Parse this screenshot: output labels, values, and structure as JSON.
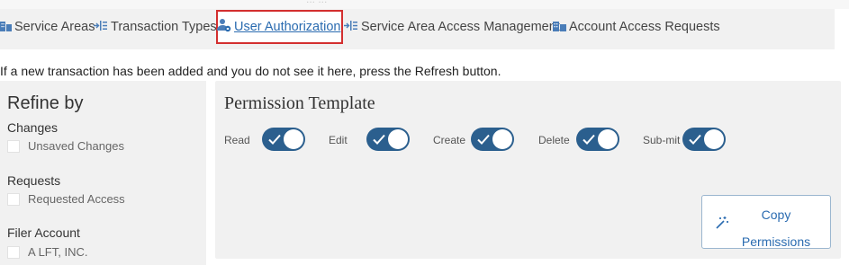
{
  "top_strip_text": "... ...",
  "tabs": [
    {
      "label": "Service Areas",
      "icon": "building-icon"
    },
    {
      "label": "Transaction Types",
      "icon": "list-arrow-icon"
    },
    {
      "label": "User Authorization",
      "icon": "user-lock-icon",
      "active": true
    },
    {
      "label": "Service Area Access Management",
      "icon": "list-arrow-icon"
    },
    {
      "label": "Account Access Requests",
      "icon": "building-icon"
    }
  ],
  "notice": "If a new transaction has been added and you do not see it here, press the Refresh button.",
  "refine": {
    "title": "Refine by",
    "groups": [
      {
        "label": "Changes",
        "option": "Unsaved Changes"
      },
      {
        "label": "Requests",
        "option": "Requested Access"
      },
      {
        "label": "Filer Account",
        "option": "A LFT, INC."
      }
    ]
  },
  "permission_template": {
    "title": "Permission Template",
    "permissions": [
      {
        "label": "Read",
        "enabled": true
      },
      {
        "label": "Edit",
        "enabled": true
      },
      {
        "label": "Create",
        "enabled": true
      },
      {
        "label": "Delete",
        "enabled": true
      },
      {
        "label": "Sub-mit",
        "enabled": true
      }
    ],
    "copy_button": {
      "line1": "Copy",
      "line2": "Permissions",
      "icon": "magic-wand-icon"
    }
  },
  "colors": {
    "accent": "#2a6bb0",
    "toggle_on": "#2b5f8e",
    "active_tab_border": "#d32f2f"
  }
}
